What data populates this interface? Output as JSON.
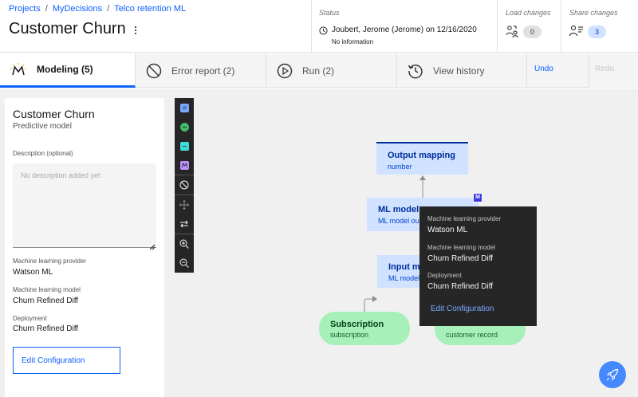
{
  "breadcrumb": [
    "Projects",
    "MyDecisions",
    "Telco retention ML"
  ],
  "breadcrumb_sep": "/",
  "page": {
    "title": "Customer Churn"
  },
  "status": {
    "label": "Status",
    "text": "Joubert, Jerome (Jerome) on 12/16/2020",
    "sub": "No information"
  },
  "load_changes": {
    "label": "Load changes",
    "count": "0"
  },
  "share_changes": {
    "label": "Share changes",
    "count": "3"
  },
  "tabs": [
    {
      "label": "Modeling (5)",
      "icon": "modeling-logo-icon",
      "active": true
    },
    {
      "label": "Error report (2)",
      "icon": "error-prohibit-icon"
    },
    {
      "label": "Run (2)",
      "icon": "play-icon"
    },
    {
      "label": "View history",
      "icon": "history-icon"
    }
  ],
  "undo_label": "Undo",
  "redo_label": "Redo",
  "panel": {
    "title": "Customer Churn",
    "subtitle": "Predictive model",
    "description_label": "Description (optional)",
    "description_placeholder": "No description added yet",
    "provider_label": "Machine learning provider",
    "provider_value": "Watson ML",
    "model_label": "Machine learning model",
    "model_value": "Churn Refined Diff",
    "deployment_label": "Deployment",
    "deployment_value": "Churn Refined Diff",
    "edit_button": "Edit Configuration"
  },
  "toolbar_icons": [
    "blue-node-icon",
    "green-node-icon",
    "teal-node-icon",
    "purple-ml-node-icon",
    "prohibit-icon",
    "move-icon",
    "swap-icon",
    "zoom-in-icon",
    "zoom-out-icon"
  ],
  "nodes": {
    "output": {
      "title": "Output mapping",
      "sub": "number"
    },
    "ml": {
      "title": "ML model",
      "sub": "ML model output"
    },
    "input": {
      "title": "Input mapping",
      "sub": "ML model input"
    },
    "subscription": {
      "title": "Subscription",
      "sub": "subscription"
    },
    "customer": {
      "sub": "customer record"
    }
  },
  "ml_badge": "M",
  "tooltip": {
    "provider_label": "Machine learning provider",
    "provider_value": "Watson ML",
    "model_label": "Machine learning model",
    "model_value": "Churn Refined Diff",
    "deployment_label": "Deployment",
    "deployment_value": "Churn Refined Diff",
    "link": "Edit Configuration"
  },
  "colors": {
    "accent": "#0f62fe",
    "node_blue": "#d0e2ff",
    "node_green": "#a7f0ba",
    "tooltip_bg": "#262626",
    "badge_ml": "#3d3bde"
  }
}
